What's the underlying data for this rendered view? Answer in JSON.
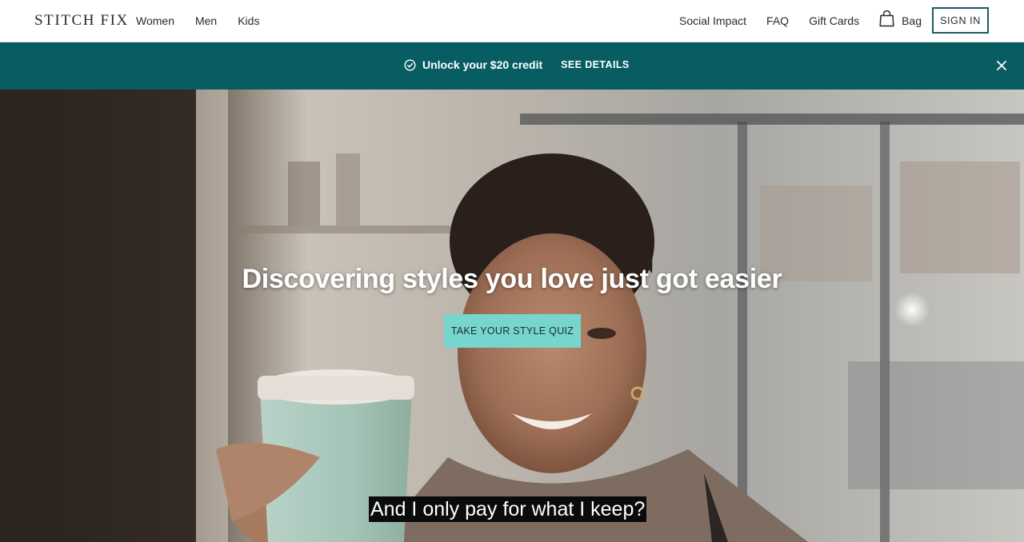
{
  "header": {
    "logo": "STITCH FIX",
    "nav_left": [
      "Women",
      "Men",
      "Kids"
    ],
    "nav_right": {
      "social_impact": "Social Impact",
      "faq": "FAQ",
      "gift_cards": "Gift Cards",
      "bag": "Bag"
    },
    "sign_in": "SIGN IN",
    "icons": {
      "bag": "shopping-bag-icon"
    }
  },
  "banner": {
    "credit_text": "Unlock your $20 credit",
    "details_label": "SEE DETAILS",
    "icons": {
      "check": "check-circle-icon",
      "close": "close-icon"
    }
  },
  "hero": {
    "title": "Discovering styles you love just got easier",
    "cta_label": "TAKE YOUR STYLE QUIZ",
    "caption": "And I only pay for what I keep?"
  },
  "colors": {
    "banner_bg": "#085d63",
    "cta_bg": "#76d6cd",
    "sign_in_border": "#1e5b64",
    "text_dark": "#1f2a30"
  }
}
